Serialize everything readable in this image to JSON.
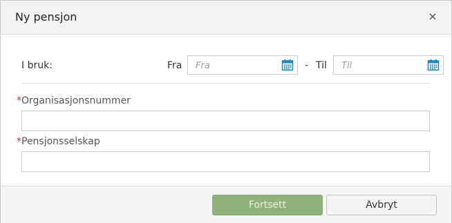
{
  "dialog": {
    "title": "Ny pensjon",
    "close_icon": "close-icon"
  },
  "in_use": {
    "label": "I bruk:",
    "from_label": "Fra",
    "from_placeholder": "Fra",
    "separator": "-",
    "to_label": "Til",
    "to_placeholder": "Til",
    "calendar_icon": "calendar-icon",
    "calendar_color": "#1a87c9"
  },
  "fields": {
    "required_marker": "*",
    "org_number_label": "Organisasjonsnummer",
    "org_number_value": "",
    "pension_company_label": "Pensjonsselskap",
    "pension_company_value": ""
  },
  "footer": {
    "continue_label": "Fortsett",
    "cancel_label": "Avbryt"
  },
  "colors": {
    "primary_button": "#8fb27a",
    "required": "#c9302c"
  }
}
